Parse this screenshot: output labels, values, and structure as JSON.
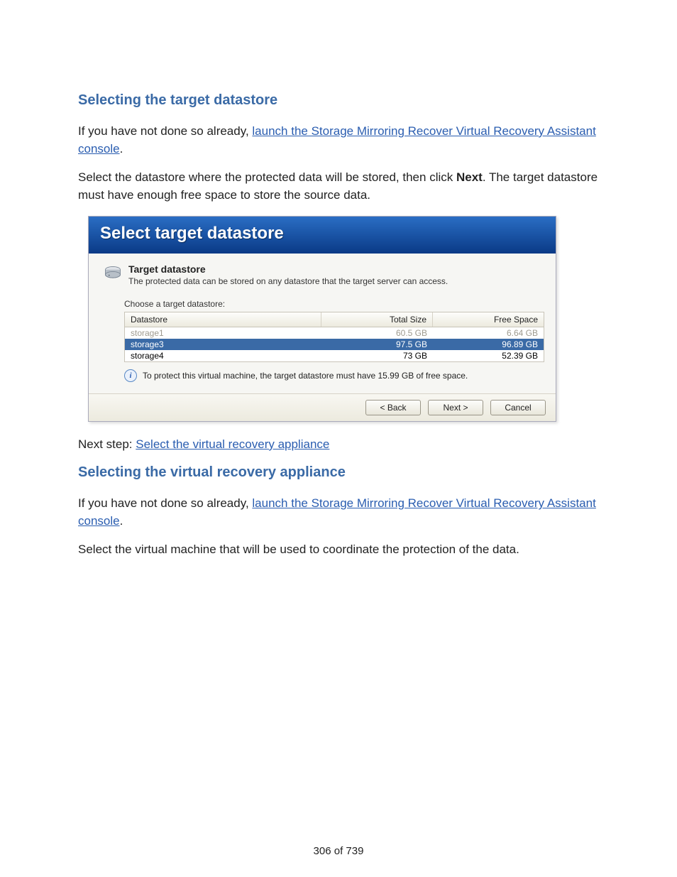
{
  "section1": {
    "title": "Selecting the target datastore",
    "para1_prefix": "If you have not done so already, ",
    "link1": "launch the Storage Mirroring Recover Virtual Recovery Assistant console",
    "para1_suffix": ".",
    "para2_a": "Select the datastore where the protected data will be stored, then click ",
    "para2_bold": "Next",
    "para2_b": ". The target datastore must have enough free space to store the source data."
  },
  "dialog": {
    "title": "Select target datastore",
    "panel_title": "Target datastore",
    "panel_sub": "The protected data can be stored on any datastore that the target server can access.",
    "choose_label": "Choose a target datastore:",
    "headers": {
      "name": "Datastore",
      "size": "Total Size",
      "free": "Free Space"
    },
    "rows": [
      {
        "name": "storage1",
        "size": "60.5 GB",
        "free": "6.64 GB",
        "state": "disabled"
      },
      {
        "name": "storage3",
        "size": "97.5 GB",
        "free": "96.89 GB",
        "state": "selected"
      },
      {
        "name": "storage4",
        "size": "73 GB",
        "free": "52.39 GB",
        "state": "normal"
      }
    ],
    "info_text": "To protect this virtual machine, the target datastore must have 15.99 GB of free space.",
    "buttons": {
      "back": "< Back",
      "next": "Next >",
      "cancel": "Cancel"
    }
  },
  "nextstep": {
    "prefix": "Next step: ",
    "link": "Select the virtual recovery appliance"
  },
  "section2": {
    "title": "Selecting the virtual recovery appliance",
    "para1_prefix": "If you have not done so already, ",
    "link1": "launch the Storage Mirroring Recover Virtual Recovery Assistant console",
    "para1_suffix": ".",
    "para2": "Select the virtual machine that will be used to coordinate the protection of the data."
  },
  "footer": {
    "page": "306 of 739"
  }
}
